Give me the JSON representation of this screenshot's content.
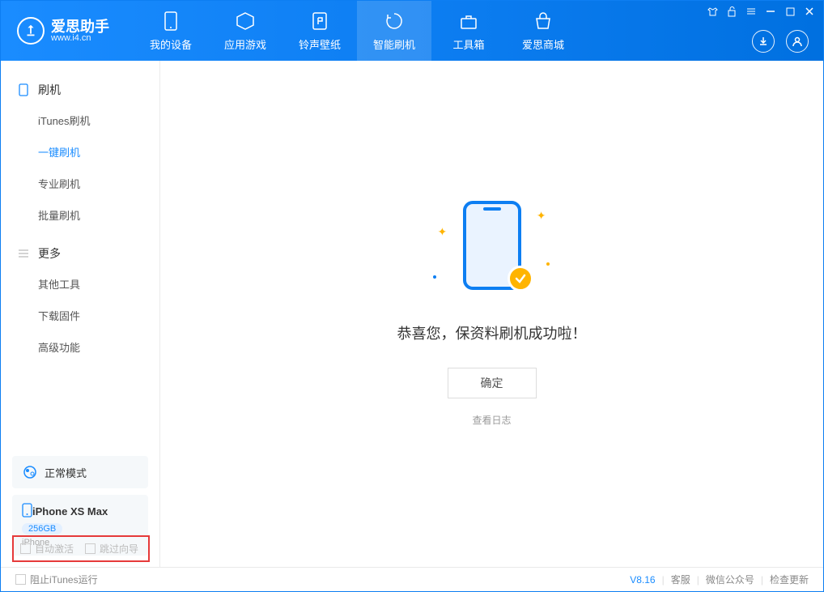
{
  "app": {
    "name": "爱思助手",
    "url": "www.i4.cn"
  },
  "tabs": {
    "device": "我的设备",
    "apps": "应用游戏",
    "ringtone": "铃声壁纸",
    "flash": "智能刷机",
    "tools": "工具箱",
    "store": "爱思商城"
  },
  "sidebar": {
    "sec1": "刷机",
    "items1": [
      "iTunes刷机",
      "一键刷机",
      "专业刷机",
      "批量刷机"
    ],
    "sec2": "更多",
    "items2": [
      "其他工具",
      "下载固件",
      "高级功能"
    ]
  },
  "mode": "正常模式",
  "device": {
    "name": "iPhone XS Max",
    "capacity": "256GB",
    "type": "iPhone"
  },
  "main": {
    "success": "恭喜您，保资料刷机成功啦！",
    "ok": "确定",
    "log": "查看日志"
  },
  "options": {
    "auto": "自动激活",
    "skip": "跳过向导"
  },
  "footer": {
    "block": "阻止iTunes运行",
    "version": "V8.16",
    "cs": "客服",
    "wechat": "微信公众号",
    "update": "检查更新"
  }
}
